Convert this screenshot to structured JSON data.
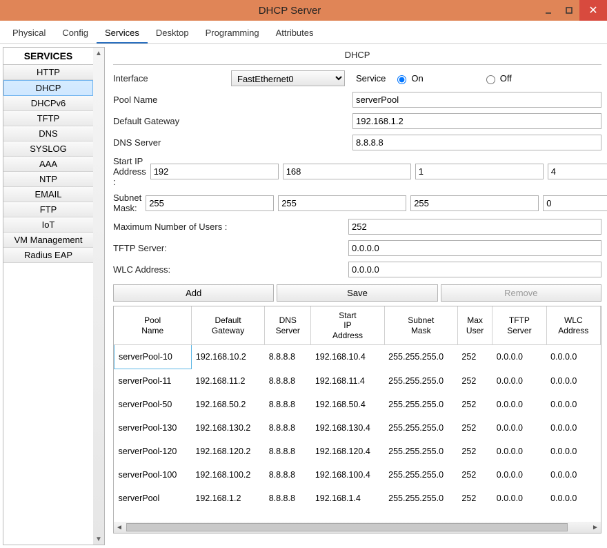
{
  "window": {
    "title": "DHCP Server"
  },
  "tabs": {
    "items": [
      "Physical",
      "Config",
      "Services",
      "Desktop",
      "Programming",
      "Attributes"
    ],
    "active": 2
  },
  "sidebar": {
    "header": "SERVICES",
    "items": [
      "HTTP",
      "DHCP",
      "DHCPv6",
      "TFTP",
      "DNS",
      "SYSLOG",
      "AAA",
      "NTP",
      "EMAIL",
      "FTP",
      "IoT",
      "VM Management",
      "Radius EAP"
    ],
    "activeIndex": 1
  },
  "page": {
    "title": "DHCP"
  },
  "form": {
    "interface_label": "Interface",
    "interface_value": "FastEthernet0",
    "service_label": "Service",
    "on_label": "On",
    "off_label": "Off",
    "service_on": true,
    "pool_name_label": "Pool Name",
    "pool_name": "serverPool",
    "default_gateway_label": "Default Gateway",
    "default_gateway": "192.168.1.2",
    "dns_label": "DNS Server",
    "dns": "8.8.8.8",
    "start_ip_label": "Start IP Address :",
    "start_ip": [
      "192",
      "168",
      "1",
      "4"
    ],
    "subnet_label": "Subnet Mask:",
    "subnet": [
      "255",
      "255",
      "255",
      "0"
    ],
    "max_users_label": "Maximum Number of Users :",
    "max_users": "252",
    "tftp_label": "TFTP Server:",
    "tftp": "0.0.0.0",
    "wlc_label": "WLC Address:",
    "wlc": "0.0.0.0"
  },
  "actions": {
    "add": "Add",
    "save": "Save",
    "remove": "Remove"
  },
  "table": {
    "headers": [
      "Pool\nName",
      "Default\nGateway",
      "DNS\nServer",
      "Start\nIP\nAddress",
      "Subnet\nMask",
      "Max\nUser",
      "TFTP\nServer",
      "WLC\nAddress"
    ],
    "rows": [
      [
        "serverPool-10",
        "192.168.10.2",
        "8.8.8.8",
        "192.168.10.4",
        "255.255.255.0",
        "252",
        "0.0.0.0",
        "0.0.0.0"
      ],
      [
        "serverPool-11",
        "192.168.11.2",
        "8.8.8.8",
        "192.168.11.4",
        "255.255.255.0",
        "252",
        "0.0.0.0",
        "0.0.0.0"
      ],
      [
        "serverPool-50",
        "192.168.50.2",
        "8.8.8.8",
        "192.168.50.4",
        "255.255.255.0",
        "252",
        "0.0.0.0",
        "0.0.0.0"
      ],
      [
        "serverPool-130",
        "192.168.130.2",
        "8.8.8.8",
        "192.168.130.4",
        "255.255.255.0",
        "252",
        "0.0.0.0",
        "0.0.0.0"
      ],
      [
        "serverPool-120",
        "192.168.120.2",
        "8.8.8.8",
        "192.168.120.4",
        "255.255.255.0",
        "252",
        "0.0.0.0",
        "0.0.0.0"
      ],
      [
        "serverPool-100",
        "192.168.100.2",
        "8.8.8.8",
        "192.168.100.4",
        "255.255.255.0",
        "252",
        "0.0.0.0",
        "0.0.0.0"
      ],
      [
        "serverPool",
        "192.168.1.2",
        "8.8.8.8",
        "192.168.1.4",
        "255.255.255.0",
        "252",
        "0.0.0.0",
        "0.0.0.0"
      ]
    ],
    "widths": [
      100,
      95,
      60,
      95,
      95,
      45,
      70,
      70
    ]
  }
}
